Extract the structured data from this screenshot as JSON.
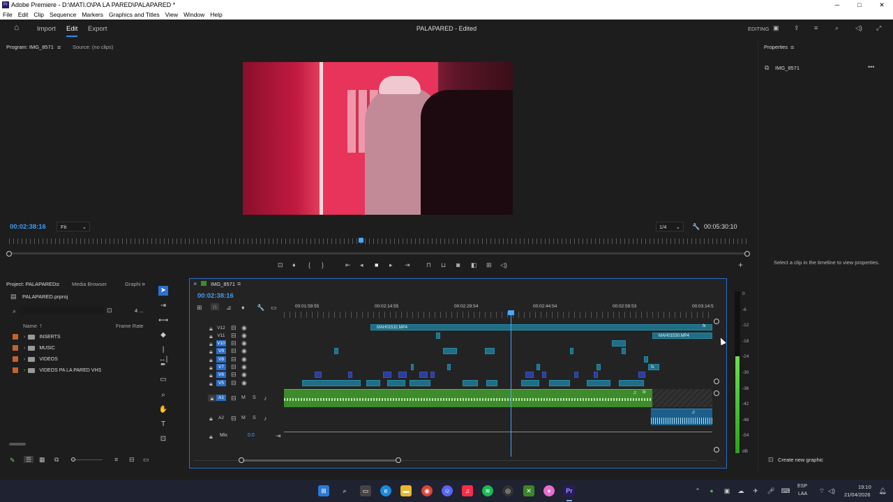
{
  "window": {
    "title": "Adobe Premiere - D:\\MATI.O\\PA LA PARED\\PALAPARED *",
    "logo": "Pr",
    "minimize": "─",
    "maximize": "□",
    "close": "✕"
  },
  "menu": [
    "File",
    "Edit",
    "Clip",
    "Sequence",
    "Markers",
    "Graphics and Titles",
    "View",
    "Window",
    "Help"
  ],
  "header": {
    "tabs": [
      "Import",
      "Edit",
      "Export"
    ],
    "active_tab": "Edit",
    "doc_title": "PALAPARED - Edited",
    "workspace": "EDITING"
  },
  "program_monitor": {
    "tab_program": "Program: IMG_8571",
    "tab_source": "Source: (no clips)",
    "timecode": "00:02:38:16",
    "fit": "Fit",
    "resolution": "1/4",
    "duration": "00:05:30:10"
  },
  "properties": {
    "tab": "Properties",
    "clip_name": "IMG_8571",
    "empty_message": "Select a clip in the timeline to view properties.",
    "new_graphic": "Create new graphic"
  },
  "project": {
    "tab_project": "Project: PALAPARED",
    "tab_media": "Media Browser",
    "tab_graphics": "Graphi",
    "file": "PALAPARED.prproj",
    "count": "4 ...",
    "col_name": "Name",
    "col_rate": "Frame Rate",
    "items": [
      "INSERTS",
      "MUSIC",
      "VIDEOS",
      "VIDEOS PA LA PARED VHS"
    ]
  },
  "timeline": {
    "tab": "IMG_8571",
    "timecode": "00:02:38:16",
    "ruler": [
      "00:01:59:55",
      "00:02:14:55",
      "00:02:29:54",
      "00:02:44:54",
      "00:02:59:53",
      "00:03:14:5"
    ],
    "video_tracks": [
      "V12",
      "V11",
      "V10",
      "V9",
      "V8",
      "V7",
      "V6",
      "V5"
    ],
    "audio_tracks": [
      "A1",
      "A2"
    ],
    "mix_label": "Mix",
    "mix_value": "0.0",
    "clip_v12": "MAH01532.MP4",
    "clip_v11": "MAH01530.MP4",
    "fx": "fx"
  },
  "meter": {
    "scale": [
      "0",
      "-6",
      "-12",
      "-18",
      "-24",
      "-30",
      "-36",
      "-42",
      "-48",
      "-54",
      "dB"
    ]
  },
  "taskbar": {
    "lang": "ESP",
    "lang2": "LAA",
    "time": "19:10",
    "date": "21/04/2026"
  }
}
